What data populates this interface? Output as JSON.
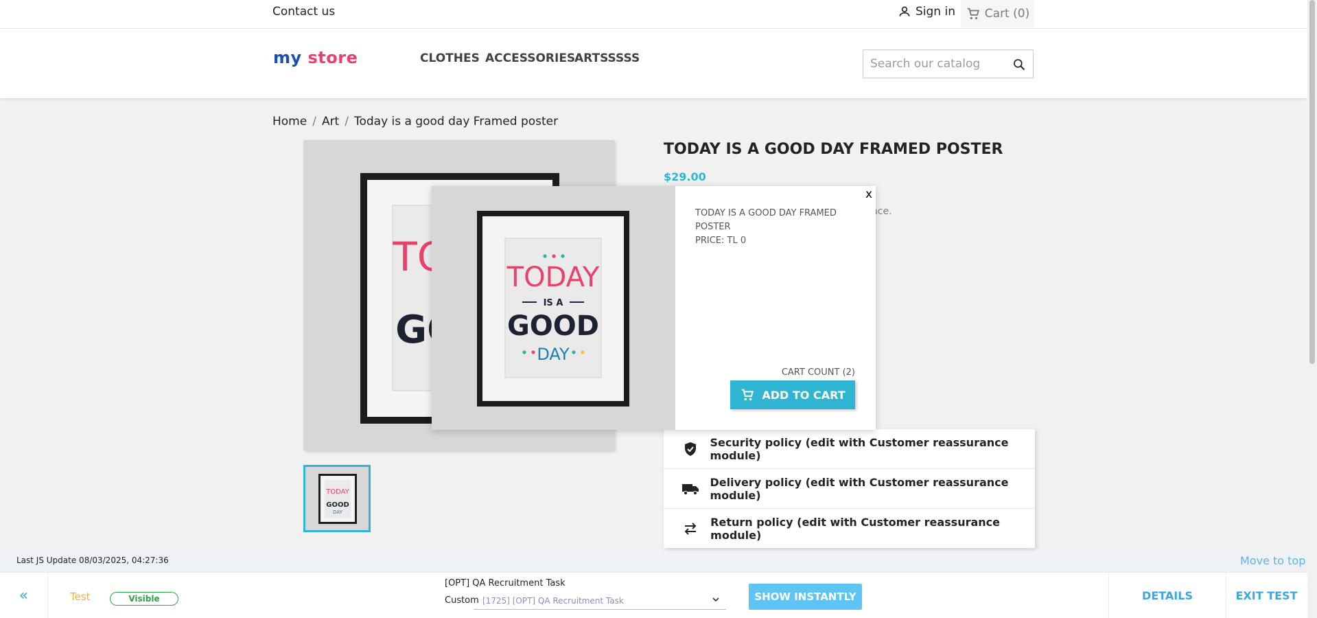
{
  "topbar": {
    "contact": "Contact us",
    "signin": "Sign in",
    "cart": "Cart (0)"
  },
  "header": {
    "logo_my": "my",
    "logo_store": "store",
    "nav": [
      "CLOTHES",
      "ACCESSORIES",
      "ARTSSSSS"
    ],
    "search_placeholder": "Search our catalog"
  },
  "breadcrumb": [
    "Home",
    "Art",
    "Today is a good day Framed poster"
  ],
  "product": {
    "title": "TODAY IS A GOOD DAY FRAMED POSTER",
    "price": "$29.00",
    "desc_fragment": "h surface.",
    "poster": {
      "line1": "TODAY",
      "line2": "IS A",
      "line3": "GOOD",
      "line4": "DAY"
    }
  },
  "popup": {
    "close": "x",
    "name": "TODAY IS A GOOD DAY FRAMED POSTER",
    "price": "PRICE: TL 0",
    "cart_count": "CART COUNT (2)",
    "add_to_cart": "ADD TO CART"
  },
  "reassurance": [
    {
      "icon": "shield-check-icon",
      "label": "Security policy (edit with Customer reassurance module)"
    },
    {
      "icon": "truck-icon",
      "label": "Delivery policy (edit with Customer reassurance module)"
    },
    {
      "icon": "swap-arrows-icon",
      "label": "Return policy (edit with Customer reassurance module)"
    }
  ],
  "debug": {
    "last_update": "Last JS Update 08/03/2025, 04:27:36",
    "move_to_top": "Move to top"
  },
  "optbar": {
    "back": "«",
    "test": "Test",
    "visible": "Visible",
    "task": "[OPT] QA Recruitment Task",
    "custom": "Custom",
    "select_value": "[1725] [OPT] QA Recruitment Task",
    "show_instantly": "SHOW INSTANTLY",
    "details": "DETAILS",
    "exit_test": "EXIT TEST"
  },
  "colors": {
    "accent": "#2fb5d2",
    "poster_pink": "#e8416b",
    "poster_navy": "#1d2233",
    "poster_blue": "#1a7fb5"
  }
}
